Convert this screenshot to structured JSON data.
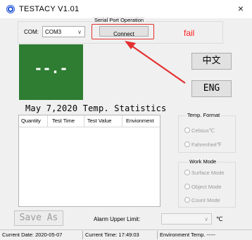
{
  "window": {
    "title": "TESTACY   V1.01",
    "close_glyph": "×"
  },
  "serial": {
    "group_label": "Serial Port Operation",
    "com_label": "COM:",
    "com_value": "COM3",
    "connect_label": "Connect"
  },
  "annotation": {
    "fail_text": "fail"
  },
  "display": {
    "readout": "--.-"
  },
  "language": {
    "chinese_label": "中文",
    "english_label": "ENG"
  },
  "stats": {
    "title": "May 7,2020 Temp. Statistics",
    "columns": [
      "Quantity",
      "Test Time",
      "Test Value",
      "Envionment"
    ]
  },
  "temp_format": {
    "group_label": "Temp. Format",
    "options": [
      "Celsius℃",
      "Fahrenheit℉"
    ]
  },
  "work_mode": {
    "group_label": "Work Mode",
    "options": [
      "Surface Mode",
      "Object Mode",
      "Count Mode"
    ]
  },
  "save_as_label": "Save As",
  "alarm": {
    "label": "Alarm Upper Limit:",
    "value": "",
    "unit": "℃"
  },
  "status": {
    "date": "Current Date:  2020-05-07",
    "time": "Current Time:  17:49:03",
    "env": "Environment Temp. -----"
  },
  "colors": {
    "display_bg": "#2e7d32",
    "annotation_red": "#e33030"
  }
}
